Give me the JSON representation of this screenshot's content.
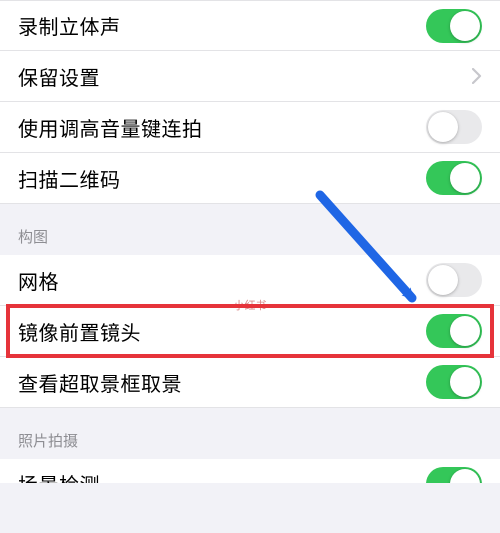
{
  "section1": {
    "items": [
      {
        "label": "录制立体声",
        "type": "toggle",
        "on": true,
        "name": "row-record-stereo"
      },
      {
        "label": "保留设置",
        "type": "nav",
        "name": "row-preserve-settings"
      },
      {
        "label": "使用调高音量键连拍",
        "type": "toggle",
        "on": false,
        "name": "row-volume-up-burst"
      },
      {
        "label": "扫描二维码",
        "type": "toggle",
        "on": true,
        "name": "row-scan-qr"
      }
    ]
  },
  "section2": {
    "header": "构图",
    "items": [
      {
        "label": "网格",
        "type": "toggle",
        "on": false,
        "name": "row-grid"
      },
      {
        "label": "镜像前置镜头",
        "type": "toggle",
        "on": true,
        "name": "row-mirror-front-camera",
        "highlight": true
      },
      {
        "label": "查看超取景框取景",
        "type": "toggle",
        "on": true,
        "name": "row-view-outside-frame"
      }
    ]
  },
  "section3": {
    "header": "照片拍摄",
    "items": [
      {
        "label": "场景检测",
        "type": "toggle",
        "on": true,
        "name": "row-scene-detection",
        "partial": true
      }
    ]
  },
  "watermark": "小红书",
  "colors": {
    "accent_on": "#34c759",
    "highlight": "#e6333a",
    "arrow": "#1f66e5"
  }
}
